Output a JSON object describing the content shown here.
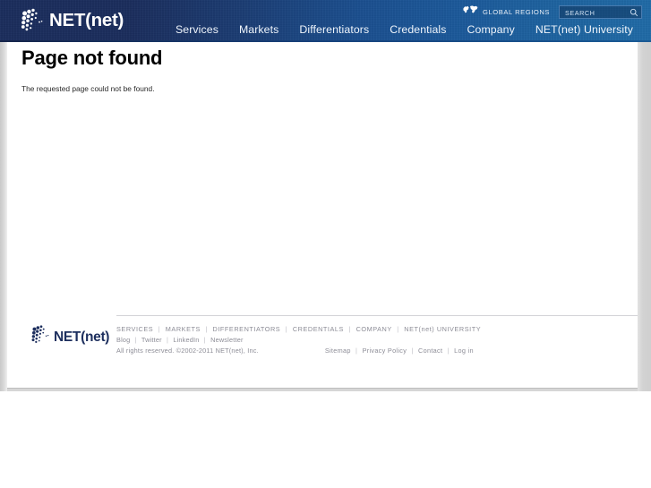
{
  "header": {
    "logo": {
      "icon": "netnet-dots-logo-icon",
      "wordmark": "NET(net)"
    },
    "global_regions": {
      "icon": "world-map-icon",
      "label": "GLOBAL REGIONS"
    },
    "search": {
      "placeholder": "SEARCH",
      "value": "",
      "icon": "search-icon"
    },
    "nav": [
      {
        "label": "Services"
      },
      {
        "label": "Markets"
      },
      {
        "label": "Differentiators"
      },
      {
        "label": "Credentials"
      },
      {
        "label": "Company"
      },
      {
        "label": "NET(net) University"
      }
    ]
  },
  "main": {
    "title": "Page not found",
    "body": "The requested page could not be found."
  },
  "footer": {
    "logo": {
      "icon": "netnet-dots-logo-icon",
      "wordmark": "NET(net)"
    },
    "primary_links": [
      {
        "label": "SERVICES"
      },
      {
        "label": "MARKETS"
      },
      {
        "label": "DIFFERENTIATORS"
      },
      {
        "label": "CREDENTIALS"
      },
      {
        "label": "COMPANY"
      },
      {
        "label": "NET(net) UNIVERSITY"
      }
    ],
    "secondary_links": [
      {
        "label": "Blog"
      },
      {
        "label": "Twitter"
      },
      {
        "label": "LinkedIn"
      },
      {
        "label": "Newsletter"
      }
    ],
    "legal": "All rights reserved. ©2002-2011 NET(net), Inc.",
    "utility_links": [
      {
        "label": "Sitemap"
      },
      {
        "label": "Privacy Policy"
      },
      {
        "label": "Contact"
      },
      {
        "label": "Log in"
      }
    ],
    "separator": "|"
  },
  "colors": {
    "header_dark": "#1a2d5c",
    "header_light": "#1f6aa6",
    "logo_navy": "#1d2f5e",
    "footer_text": "#8c8c96",
    "page_background": "#ffffff",
    "chrome_gray": "#d6d6d6"
  }
}
